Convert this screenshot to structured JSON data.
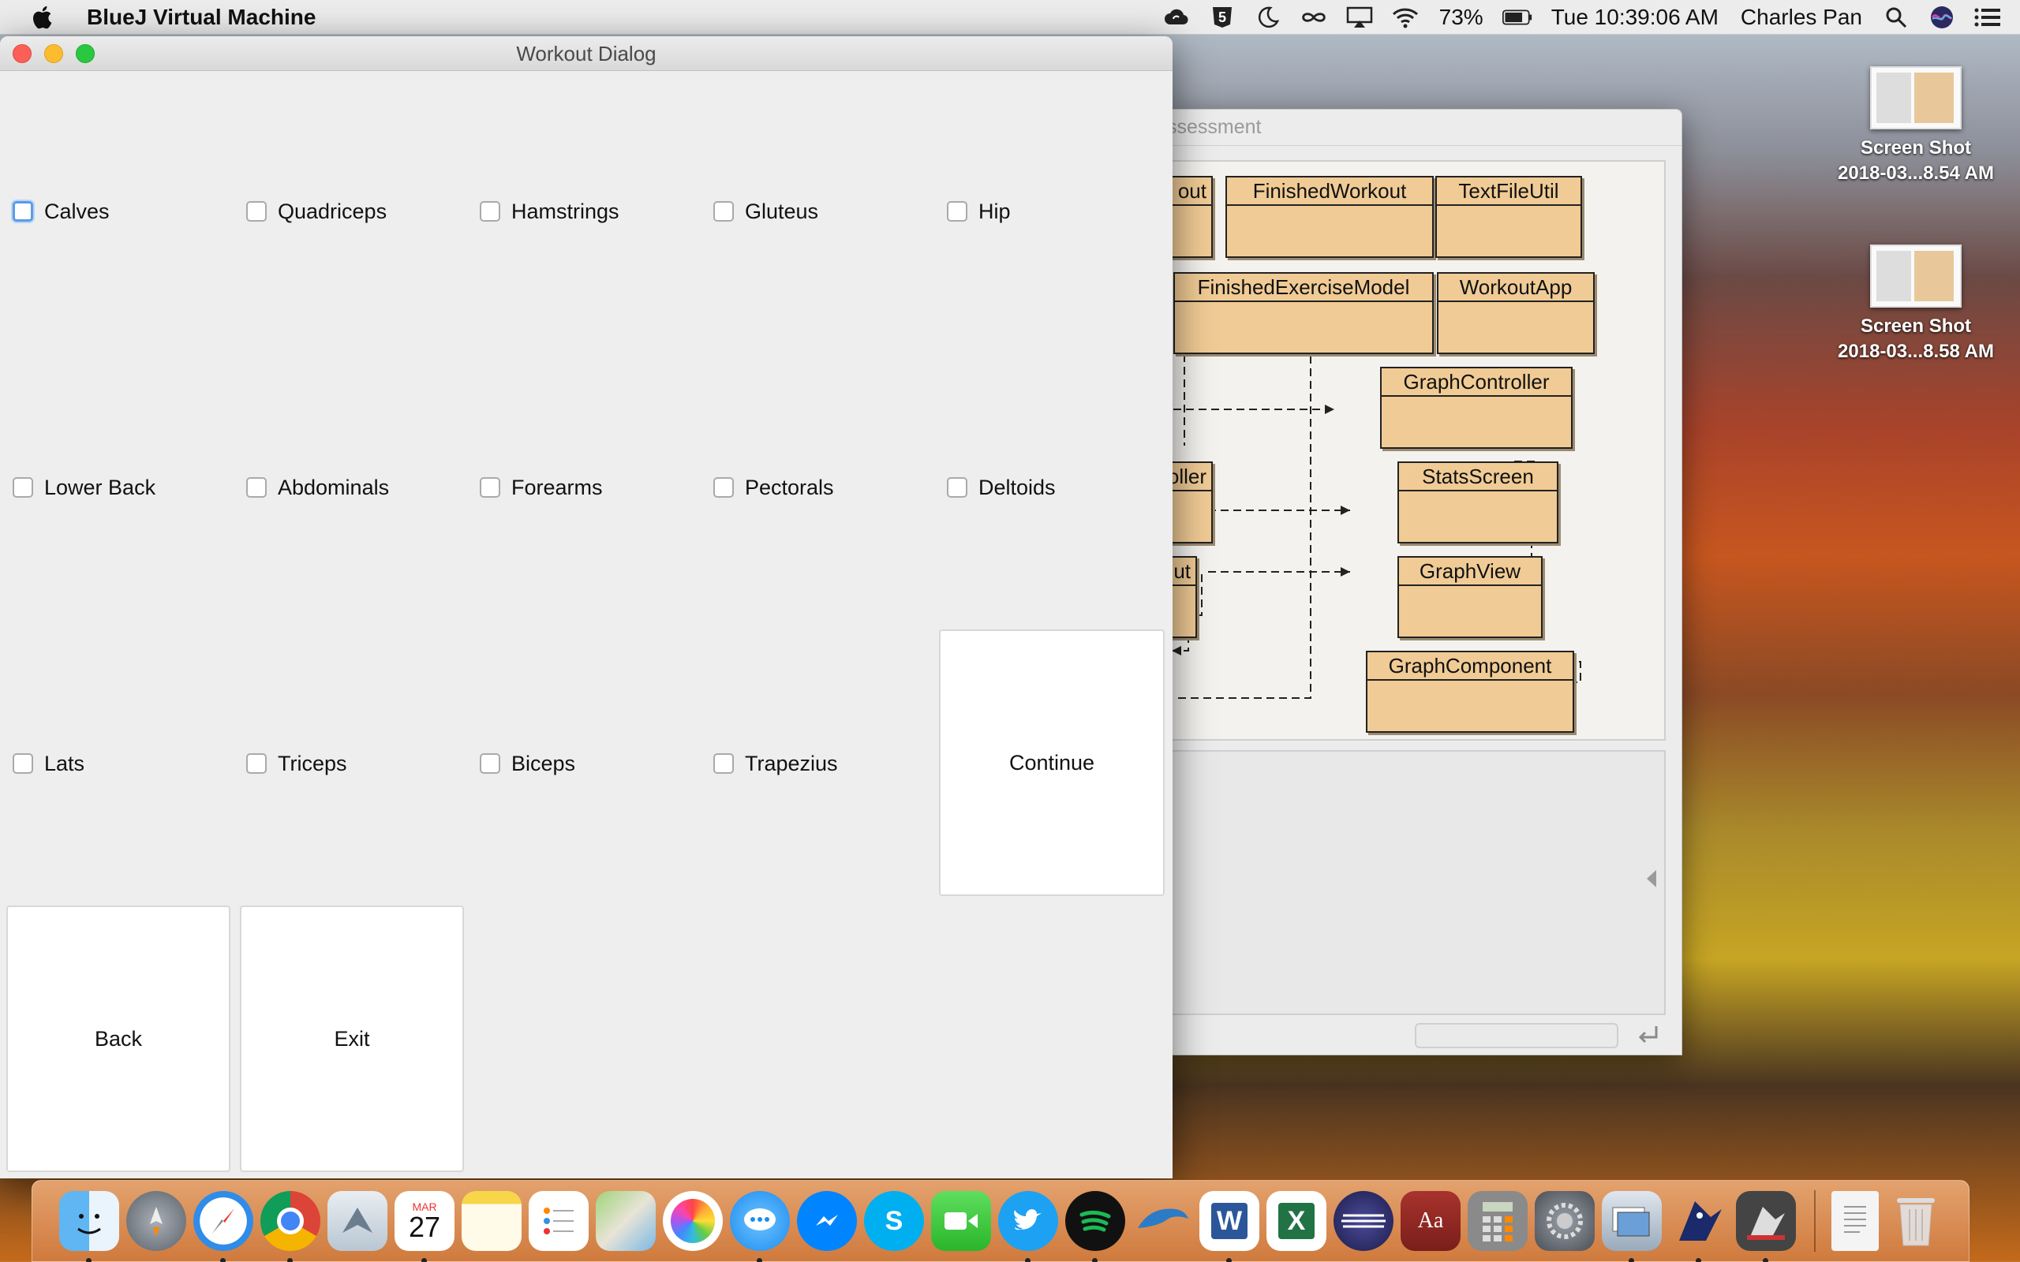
{
  "menubar": {
    "app_name": "BlueJ Virtual Machine",
    "battery": "73%",
    "clock": "Tue 10:39:06 AM",
    "user": "Charles Pan",
    "icons": [
      "apple-icon",
      "sync-icon",
      "five-icon",
      "moon-icon",
      "infinity-icon",
      "airplay-icon",
      "wifi-icon",
      "battery-icon",
      "spotlight-icon",
      "siri-icon",
      "notification-center-icon"
    ]
  },
  "desktop": {
    "files": [
      {
        "line1": "Screen Shot",
        "line2": "2018-03...8.54 AM"
      },
      {
        "line1": "Screen Shot",
        "line2": "2018-03...8.58 AM"
      }
    ]
  },
  "bluej": {
    "title": "ssessment",
    "classes": [
      "out",
      "FinishedWorkout",
      "TextFileUtil",
      "FinishedExerciseModel",
      "WorkoutApp",
      "GraphController",
      "oller",
      "StatsScreen",
      "ut",
      "GraphView",
      "GraphComponent"
    ]
  },
  "dialog": {
    "title": "Workout Dialog",
    "muscles": [
      "Calves",
      "Quadriceps",
      "Hamstrings",
      "Gluteus",
      "Hip",
      "Lower Back",
      "Abdominals",
      "Forearms",
      "Pectorals",
      "Deltoids",
      "Lats",
      "Triceps",
      "Biceps",
      "Trapezius"
    ],
    "buttons": {
      "continue": "Continue",
      "back": "Back",
      "exit": "Exit"
    }
  },
  "dock": {
    "items": [
      "finder-icon",
      "launchpad-icon",
      "safari-icon",
      "chrome-icon",
      "mail-icon",
      "calendar-icon",
      "notes-icon",
      "reminders-icon",
      "maps-icon",
      "photos-icon",
      "messages-icon",
      "messenger-icon",
      "skype-icon",
      "facetime-icon",
      "twitter-icon",
      "spotify-icon",
      "dolphin-icon",
      "word-icon",
      "excel-icon",
      "eclipse-icon",
      "dictionary-icon",
      "calculator-icon",
      "system-preferences-icon",
      "preview-icon",
      "bluej-icon",
      "bluej-project-icon",
      "document-icon",
      "trash-icon"
    ],
    "calendar": {
      "month": "MAR",
      "day": "27"
    },
    "dictionary_label": "Aa",
    "word_letter": "W",
    "excel_letter": "X",
    "skype_letter": "S",
    "colors": {
      "chrome_red": "#db4437",
      "word_blue": "#2b579a",
      "excel_green": "#217346",
      "spotify_green": "#1db954",
      "twitter_blue": "#1da1f2",
      "messenger_blue": "#0084ff"
    }
  }
}
